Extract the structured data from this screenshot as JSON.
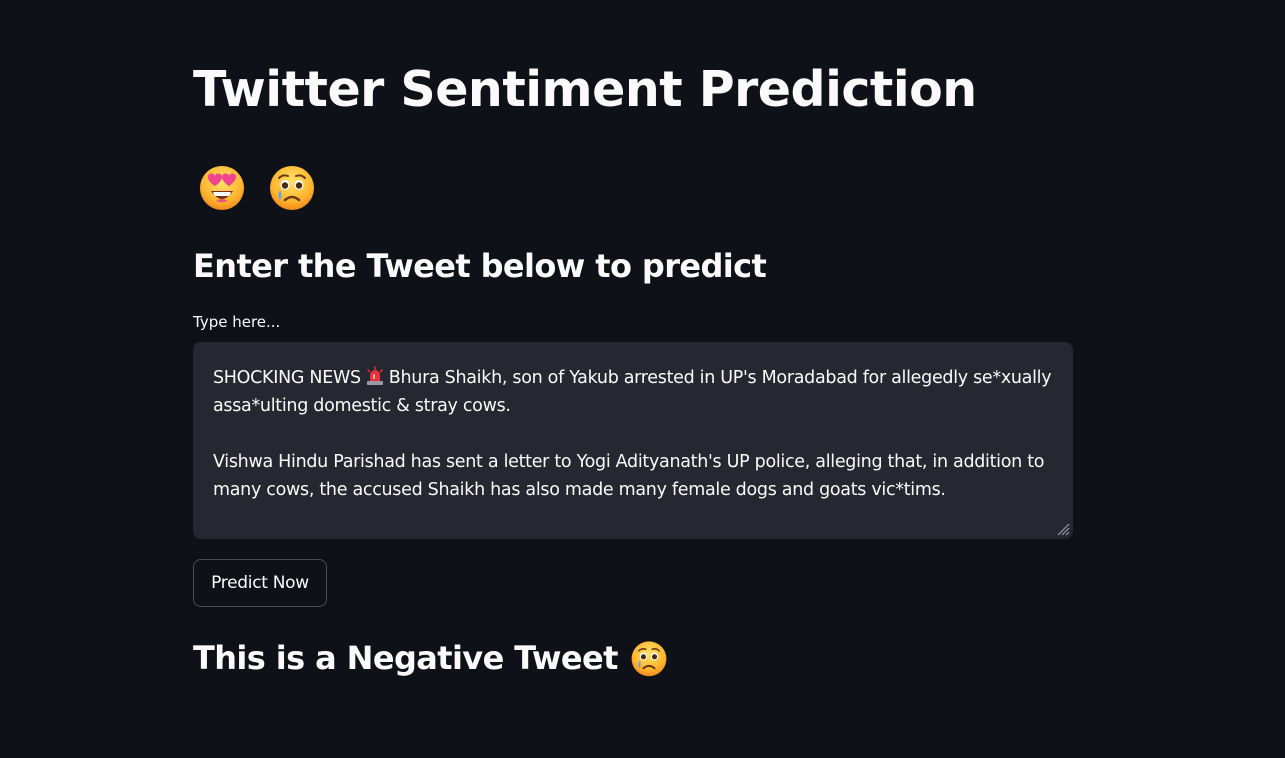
{
  "page": {
    "title": "Twitter Sentiment Prediction",
    "header_emojis": [
      "star-struck-emoji",
      "crying-face-emoji"
    ],
    "subheader": "Enter the Tweet below to predict"
  },
  "input": {
    "label": "Type here...",
    "lines": [
      {
        "before": "SHOCKING NEWS",
        "icon": "police-siren-emoji",
        "after": "Bhura Shaikh, son of Yakub arrested in UP's Moradabad for allegedly se*xually"
      },
      "assa*ulting domestic & stray cows.",
      "",
      "Vishwa Hindu Parishad has sent a letter to Yogi Adityanath's UP police, alleging that, in addition to",
      "many cows, the accused Shaikh has also made many female dogs and goats vic*tims."
    ]
  },
  "button": {
    "label": "Predict Now"
  },
  "result": {
    "text": "This is a Negative Tweet",
    "icon": "crying-face-emoji"
  },
  "colors": {
    "background": "#0e1117",
    "input_background": "#262730",
    "text": "#fafafa"
  }
}
